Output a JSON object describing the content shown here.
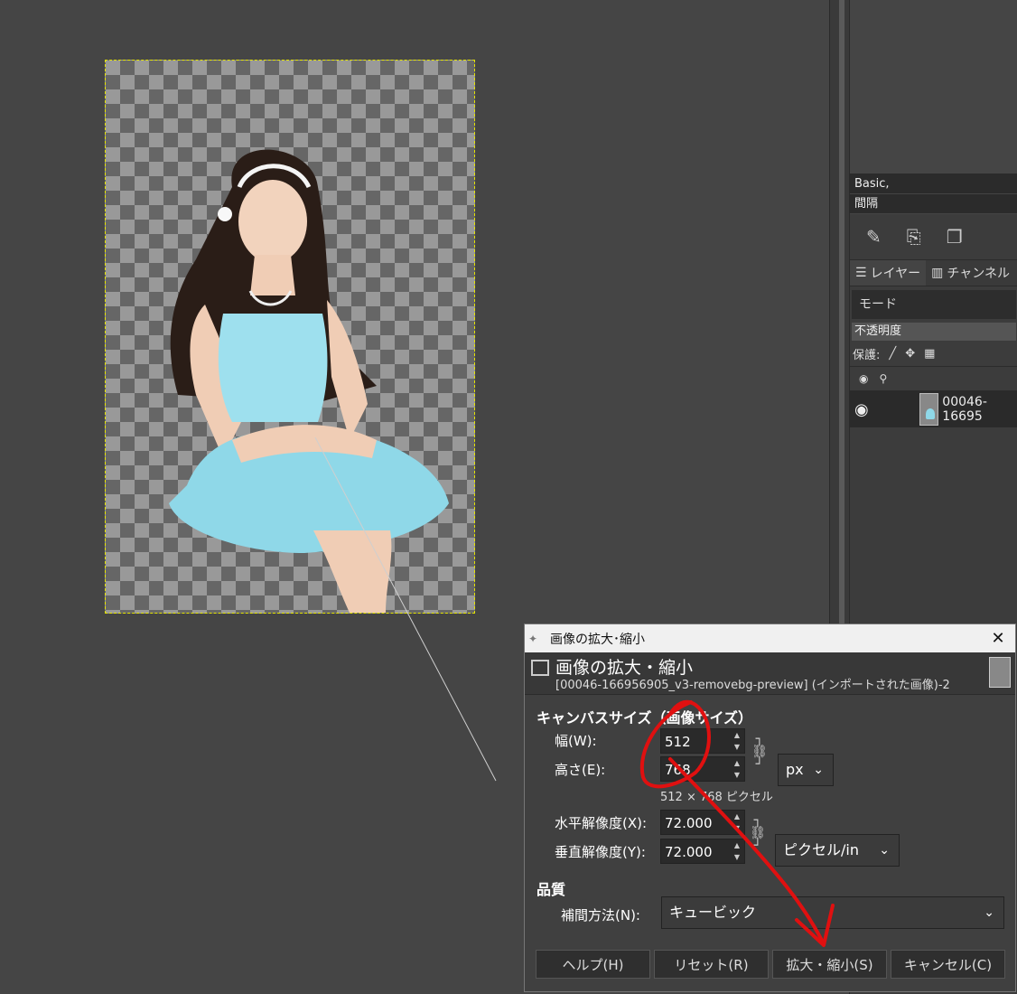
{
  "right_panel": {
    "brush_preset": "Basic,",
    "spacing_label": "間隔",
    "tabs": [
      {
        "label": "レイヤー",
        "icon": "layers-icon"
      },
      {
        "label": "チャンネル",
        "icon": "channels-icon"
      }
    ],
    "mode_label": "モード",
    "opacity_label": "不透明度",
    "protect_label": "保護:",
    "layer_name": "00046-16695"
  },
  "dialog": {
    "window_title": "画像の拡大･縮小",
    "header_title": "画像の拡大・縮小",
    "header_subtitle": "[00046-166956905_v3-removebg-preview] (インポートされた画像)-2",
    "canvas_section": "キャンバスサイズ（画像サイズ）",
    "width_label": "幅(W):",
    "width_value": "512",
    "height_label": "高さ(E):",
    "height_value": "768",
    "unit": "px",
    "pixel_info": "512 × 768 ピクセル",
    "xres_label": "水平解像度(X):",
    "xres_value": "72.000",
    "yres_label": "垂直解像度(Y):",
    "yres_value": "72.000",
    "res_unit": "ピクセル/in",
    "quality_section": "品質",
    "interp_label": "補間方法(N):",
    "interp_value": "キュービック",
    "buttons": {
      "help": "ヘルプ(H)",
      "reset": "リセット(R)",
      "scale": "拡大・縮小(S)",
      "cancel": "キャンセル(C)"
    }
  },
  "colors": {
    "canvas_bg": "#454545",
    "selection_border": "#e6e600",
    "annotation": "#e01010",
    "dress": "#8fd8e8"
  }
}
